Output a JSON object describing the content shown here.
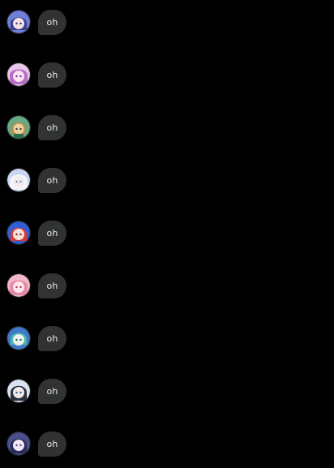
{
  "messages": [
    {
      "text": "oh",
      "avatar": {
        "icon": "anime-avatar-blue-hair",
        "bg": "#6f7fd8",
        "hair": "#3b3f8f",
        "skin": "#f3e3e6"
      }
    },
    {
      "text": "oh",
      "avatar": {
        "icon": "anime-avatar-pink-hair",
        "bg": "#e6c6e9",
        "hair": "#b86bc7",
        "skin": "#f8e4ee"
      }
    },
    {
      "text": "oh",
      "avatar": {
        "icon": "anime-avatar-green-character",
        "bg": "#66a982",
        "hair": "#c58b43",
        "skin": "#e6d3a2"
      }
    },
    {
      "text": "oh",
      "avatar": {
        "icon": "anime-avatar-white-hair",
        "bg": "#c9d6f2",
        "hair": "#f2f5fb",
        "skin": "#f4ecec"
      }
    },
    {
      "text": "oh",
      "avatar": {
        "icon": "anime-avatar-red-hair",
        "bg": "#2f5fd6",
        "hair": "#d83b3b",
        "skin": "#f7e2d8"
      }
    },
    {
      "text": "oh",
      "avatar": {
        "icon": "anime-avatar-pink-hair",
        "bg": "#f1b9c8",
        "hair": "#e58aa6",
        "skin": "#fbe6ec"
      }
    },
    {
      "text": "oh",
      "avatar": {
        "icon": "anime-avatar-teal-hair",
        "bg": "#3f79c8",
        "hair": "#49b8b0",
        "skin": "#eef2ee"
      }
    },
    {
      "text": "oh",
      "avatar": {
        "icon": "anime-avatar-dark-hair",
        "bg": "#d9e3f2",
        "hair": "#2b2f3d",
        "skin": "#f1e8e8"
      }
    },
    {
      "text": "oh",
      "avatar": {
        "icon": "anime-avatar-purple-hair",
        "bg": "#4a4f8d",
        "hair": "#2a2d5a",
        "skin": "#f0e7f2"
      }
    }
  ],
  "theme": {
    "background": "#000000",
    "bubble": "#303233",
    "text": "#e9e9e9"
  }
}
